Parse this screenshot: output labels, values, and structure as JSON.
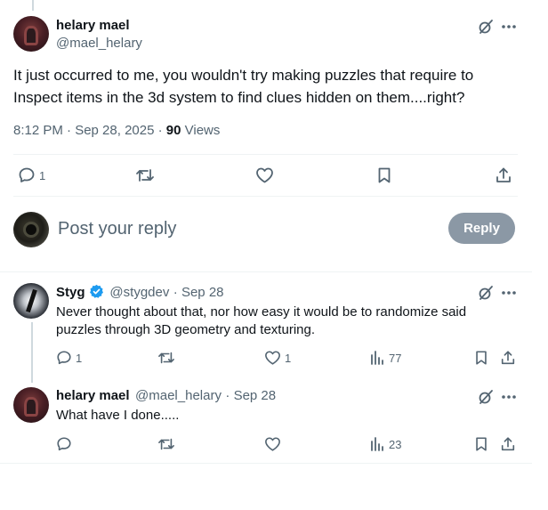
{
  "main_tweet": {
    "display_name": "helary mael",
    "handle": "@mael_helary",
    "text": "It just occurred to me, you wouldn't try making puzzles that require to Inspect items in the 3d system to find clues hidden on them....right?",
    "time": "8:12 PM · Sep 28, 2025 ·",
    "views_count": "90",
    "views_label": "Views",
    "replies": "1"
  },
  "reply_box": {
    "placeholder": "Post your reply",
    "button_label": "Reply"
  },
  "replies": [
    {
      "display_name": "Styg",
      "handle": "@stygdev",
      "date": "· Sep 28",
      "text": "Never thought about that, nor how easy it would be to randomize said puzzles through 3D geometry and texturing.",
      "replies": "1",
      "retweets": "",
      "likes": "1",
      "views": "77"
    },
    {
      "display_name": "helary mael",
      "handle": "@mael_helary",
      "date": "· Sep 28",
      "text": "What have I done.....",
      "replies": "",
      "retweets": "",
      "likes": "",
      "views": "23"
    }
  ],
  "colors": {
    "text": "#0f1419",
    "secondary": "#536471",
    "verified": "#1d9bf0",
    "reply_button": "#8b98a5",
    "divider": "#eff3f4"
  }
}
